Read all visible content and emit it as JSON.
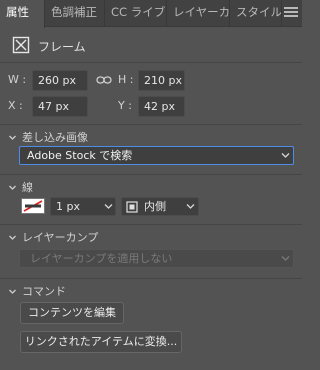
{
  "tabs": [
    {
      "label": "属性"
    },
    {
      "label": "色調補正"
    },
    {
      "label": "CC ライブラ"
    },
    {
      "label": "レイヤーカン"
    },
    {
      "label": "スタイル"
    }
  ],
  "header": {
    "title": "フレーム"
  },
  "dimensions": {
    "w_label": "W :",
    "w_value": "260 px",
    "h_label": "H :",
    "h_value": "210 px",
    "x_label": "X :",
    "x_value": "47 px",
    "y_label": "Y :",
    "y_value": "42 px"
  },
  "insert_image": {
    "title": "差し込み画像",
    "selected": "Adobe Stock で検索"
  },
  "stroke": {
    "title": "線",
    "width": "1 px",
    "position": "内側"
  },
  "layer_comp": {
    "title": "レイヤーカンプ",
    "placeholder": "レイヤーカンプを適用しない"
  },
  "commands": {
    "title": "コマンド",
    "edit_contents": "コンテンツを編集",
    "convert_linked": "リンクされたアイテムに変換..."
  },
  "colors": {
    "accent": "#4f8ce5",
    "panel": "#535353",
    "tabbar": "#424242"
  }
}
